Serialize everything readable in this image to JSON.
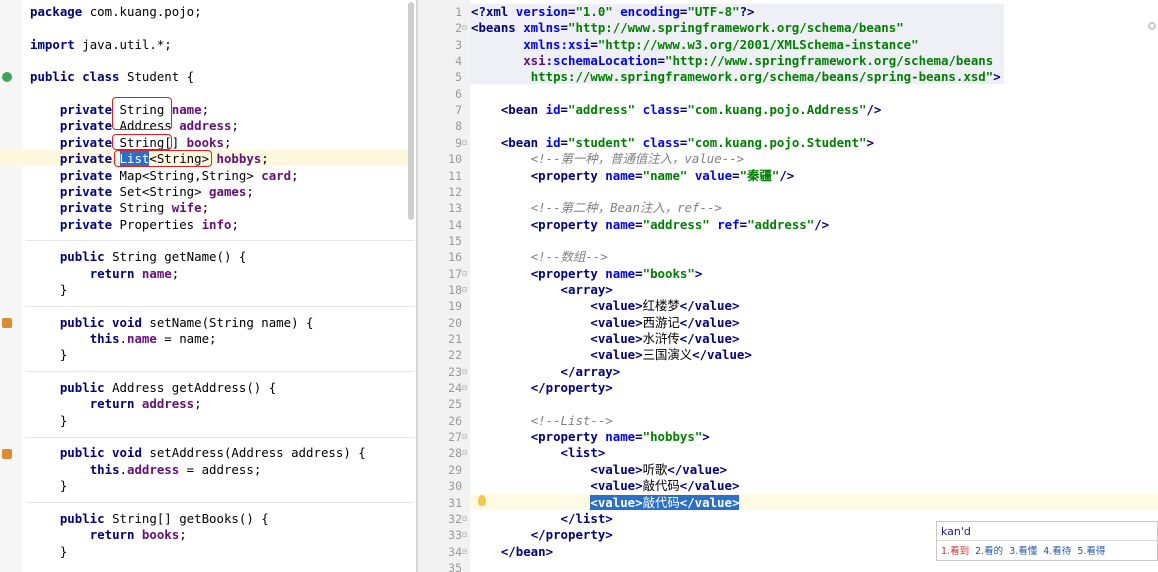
{
  "left_editor": {
    "lines": [
      {
        "parts": [
          [
            "kw",
            "package"
          ],
          [
            "",
            "com.kuang.pojo;"
          ]
        ]
      },
      {
        "parts": []
      },
      {
        "parts": [
          [
            "kw",
            "import"
          ],
          [
            "",
            "java.util.*;"
          ]
        ]
      },
      {
        "parts": []
      },
      {
        "parts": [
          [
            "kw",
            "public class"
          ],
          [
            "",
            "Student {"
          ]
        ]
      },
      {
        "parts": []
      },
      {
        "parts": [
          [
            "",
            "    "
          ],
          [
            "kw",
            "private"
          ],
          [
            "",
            " String "
          ],
          [
            "fld",
            "name"
          ],
          [
            "",
            ";"
          ]
        ]
      },
      {
        "parts": [
          [
            "",
            "    "
          ],
          [
            "kw",
            "private"
          ],
          [
            "",
            " Address "
          ],
          [
            "fld",
            "address"
          ],
          [
            "",
            ";"
          ]
        ]
      },
      {
        "parts": [
          [
            "",
            "    "
          ],
          [
            "kw",
            "private"
          ],
          [
            "",
            " String[] "
          ],
          [
            "fld",
            "books"
          ],
          [
            "",
            ";"
          ]
        ]
      },
      {
        "parts": [
          [
            "",
            "    "
          ],
          [
            "kw",
            "private"
          ],
          [
            "",
            ""
          ],
          [
            "sel",
            "List"
          ],
          [
            "",
            "<String> "
          ],
          [
            "fld",
            "hobbys"
          ],
          [
            "",
            ";"
          ]
        ]
      },
      {
        "parts": [
          [
            "",
            "    "
          ],
          [
            "kw",
            "private"
          ],
          [
            "",
            " Map<String,String> "
          ],
          [
            "fld",
            "card"
          ],
          [
            "",
            ";"
          ]
        ]
      },
      {
        "parts": [
          [
            "",
            "    "
          ],
          [
            "kw",
            "private"
          ],
          [
            "",
            " Set<String> "
          ],
          [
            "fld",
            "games"
          ],
          [
            "",
            ";"
          ]
        ]
      },
      {
        "parts": [
          [
            "",
            "    "
          ],
          [
            "kw",
            "private"
          ],
          [
            "",
            " String "
          ],
          [
            "fld",
            "wife"
          ],
          [
            "",
            ";"
          ]
        ]
      },
      {
        "parts": [
          [
            "",
            "    "
          ],
          [
            "kw",
            "private"
          ],
          [
            "",
            " Properties "
          ],
          [
            "fld",
            "info"
          ],
          [
            "",
            ";"
          ]
        ]
      },
      {
        "parts": []
      },
      {
        "parts": [
          [
            "",
            "    "
          ],
          [
            "kw",
            "public"
          ],
          [
            "",
            " String getName() {"
          ]
        ]
      },
      {
        "parts": [
          [
            "",
            "        "
          ],
          [
            "kw",
            "return"
          ],
          [
            "fld",
            "name"
          ],
          [
            "",
            ";"
          ]
        ]
      },
      {
        "parts": [
          [
            "",
            "    }"
          ]
        ]
      },
      {
        "parts": []
      },
      {
        "parts": [
          [
            "",
            "    "
          ],
          [
            "kw",
            "public void"
          ],
          [
            "",
            " setName(String name) {"
          ]
        ]
      },
      {
        "parts": [
          [
            "",
            "        "
          ],
          [
            "kw",
            "this"
          ],
          [
            "",
            "."
          ],
          [
            "fld",
            "name"
          ],
          [
            "",
            " = name;"
          ]
        ]
      },
      {
        "parts": [
          [
            "",
            "    }"
          ]
        ]
      },
      {
        "parts": []
      },
      {
        "parts": [
          [
            "",
            "    "
          ],
          [
            "kw",
            "public"
          ],
          [
            "",
            " Address getAddress() {"
          ]
        ]
      },
      {
        "parts": [
          [
            "",
            "        "
          ],
          [
            "kw",
            "return"
          ],
          [
            "fld",
            "address"
          ],
          [
            "",
            ";"
          ]
        ]
      },
      {
        "parts": [
          [
            "",
            "    }"
          ]
        ]
      },
      {
        "parts": []
      },
      {
        "parts": [
          [
            "",
            "    "
          ],
          [
            "kw",
            "public void"
          ],
          [
            "",
            " setAddress(Address address) {"
          ]
        ]
      },
      {
        "parts": [
          [
            "",
            "        "
          ],
          [
            "kw",
            "this"
          ],
          [
            "",
            "."
          ],
          [
            "fld",
            "address"
          ],
          [
            "",
            " = address;"
          ]
        ]
      },
      {
        "parts": [
          [
            "",
            "    }"
          ]
        ]
      },
      {
        "parts": []
      },
      {
        "parts": [
          [
            "",
            "    "
          ],
          [
            "kw",
            "public"
          ],
          [
            "",
            " String[] getBooks() {"
          ]
        ]
      },
      {
        "parts": [
          [
            "",
            "        "
          ],
          [
            "kw",
            "return"
          ],
          [
            "fld",
            "books"
          ],
          [
            "",
            ";"
          ]
        ]
      },
      {
        "parts": [
          [
            "",
            "    }"
          ]
        ]
      }
    ]
  },
  "right_editor": {
    "line_numbers": [
      "1",
      "2",
      "3",
      "4",
      "5",
      "6",
      "7",
      "8",
      "9",
      "10",
      "11",
      "12",
      "13",
      "14",
      "15",
      "16",
      "17",
      "18",
      "19",
      "20",
      "21",
      "22",
      "23",
      "24",
      "25",
      "26",
      "27",
      "28",
      "29",
      "30",
      "31",
      "32",
      "33",
      "34",
      "35"
    ],
    "lines": [
      {
        "parts": [
          [
            "tag",
            "<?xml "
          ],
          [
            "attr",
            "version"
          ],
          [
            "tag",
            "="
          ],
          [
            "val",
            "\"1.0\" "
          ],
          [
            "attr",
            "encoding"
          ],
          [
            "tag",
            "="
          ],
          [
            "val",
            "\"UTF-8\""
          ],
          [
            "tag",
            "?>"
          ]
        ]
      },
      {
        "parts": [
          [
            "tag",
            "<beans "
          ],
          [
            "attr",
            "xmlns"
          ],
          [
            "tag",
            "="
          ],
          [
            "val",
            "\"http://www.springframework.org/schema/beans\""
          ]
        ]
      },
      {
        "parts": [
          [
            "",
            "       "
          ],
          [
            "attr",
            "xmlns:xsi"
          ],
          [
            "tag",
            "="
          ],
          [
            "val",
            "\"http://www.w3.org/2001/XMLSchema-instance\""
          ]
        ]
      },
      {
        "parts": [
          [
            "",
            "       "
          ],
          [
            "ns",
            "xsi"
          ],
          [
            "attr",
            ":schemaLocation"
          ],
          [
            "tag",
            "="
          ],
          [
            "val",
            "\"http://www.springframework.org/schema/beans"
          ]
        ]
      },
      {
        "parts": [
          [
            "",
            "        "
          ],
          [
            "val",
            "https://www.springframework.org/schema/beans/spring-beans.xsd\""
          ],
          [
            "tag",
            ">"
          ]
        ]
      },
      {
        "parts": []
      },
      {
        "parts": [
          [
            "",
            "    "
          ],
          [
            "tag",
            "<bean "
          ],
          [
            "attr",
            "id"
          ],
          [
            "tag",
            "="
          ],
          [
            "val",
            "\"address\" "
          ],
          [
            "attr",
            "class"
          ],
          [
            "tag",
            "="
          ],
          [
            "val",
            "\"com.kuang.pojo.Address\""
          ],
          [
            "tag",
            "/>"
          ]
        ]
      },
      {
        "parts": []
      },
      {
        "parts": [
          [
            "",
            "    "
          ],
          [
            "tag",
            "<bean "
          ],
          [
            "attr",
            "id"
          ],
          [
            "tag",
            "="
          ],
          [
            "val",
            "\"student\" "
          ],
          [
            "attr",
            "class"
          ],
          [
            "tag",
            "="
          ],
          [
            "val",
            "\"com.kuang.pojo.Student\""
          ],
          [
            "tag",
            ">"
          ]
        ]
      },
      {
        "parts": [
          [
            "",
            "        "
          ],
          [
            "cmt",
            "<!--第一种，普通值注入，value-->"
          ]
        ]
      },
      {
        "parts": [
          [
            "",
            "        "
          ],
          [
            "tag",
            "<property "
          ],
          [
            "attr",
            "name"
          ],
          [
            "tag",
            "="
          ],
          [
            "val",
            "\"name\" "
          ],
          [
            "attr",
            "value"
          ],
          [
            "tag",
            "="
          ],
          [
            "val",
            "\"秦疆\""
          ],
          [
            "tag",
            "/>"
          ]
        ]
      },
      {
        "parts": []
      },
      {
        "parts": [
          [
            "",
            "        "
          ],
          [
            "cmt",
            "<!--第二种，Bean注入，ref-->"
          ]
        ]
      },
      {
        "parts": [
          [
            "",
            "        "
          ],
          [
            "tag",
            "<property "
          ],
          [
            "attr",
            "name"
          ],
          [
            "tag",
            "="
          ],
          [
            "val",
            "\"address\" "
          ],
          [
            "attr",
            "ref"
          ],
          [
            "tag",
            "="
          ],
          [
            "val",
            "\"address\""
          ],
          [
            "tag",
            "/>"
          ]
        ]
      },
      {
        "parts": []
      },
      {
        "parts": [
          [
            "",
            "        "
          ],
          [
            "cmt",
            "<!--数组-->"
          ]
        ]
      },
      {
        "parts": [
          [
            "",
            "        "
          ],
          [
            "tag",
            "<property "
          ],
          [
            "attr",
            "name"
          ],
          [
            "tag",
            "="
          ],
          [
            "val",
            "\"books\""
          ],
          [
            "tag",
            ">"
          ]
        ]
      },
      {
        "parts": [
          [
            "",
            "            "
          ],
          [
            "tag",
            "<array>"
          ]
        ]
      },
      {
        "parts": [
          [
            "",
            "                "
          ],
          [
            "tag",
            "<value>"
          ],
          [
            "",
            "红楼梦"
          ],
          [
            "tag",
            "</value>"
          ]
        ]
      },
      {
        "parts": [
          [
            "",
            "                "
          ],
          [
            "tag",
            "<value>"
          ],
          [
            "",
            "西游记"
          ],
          [
            "tag",
            "</value>"
          ]
        ]
      },
      {
        "parts": [
          [
            "",
            "                "
          ],
          [
            "tag",
            "<value>"
          ],
          [
            "",
            "水浒传"
          ],
          [
            "tag",
            "</value>"
          ]
        ]
      },
      {
        "parts": [
          [
            "",
            "                "
          ],
          [
            "tag",
            "<value>"
          ],
          [
            "",
            "三国演义"
          ],
          [
            "tag",
            "</value>"
          ]
        ]
      },
      {
        "parts": [
          [
            "",
            "            "
          ],
          [
            "tag",
            "</array>"
          ]
        ]
      },
      {
        "parts": [
          [
            "",
            "        "
          ],
          [
            "tag",
            "</property>"
          ]
        ]
      },
      {
        "parts": []
      },
      {
        "parts": [
          [
            "",
            "        "
          ],
          [
            "cmt",
            "<!--List-->"
          ]
        ]
      },
      {
        "parts": [
          [
            "",
            "        "
          ],
          [
            "tag",
            "<property "
          ],
          [
            "attr",
            "name"
          ],
          [
            "tag",
            "="
          ],
          [
            "val",
            "\"hobbys\""
          ],
          [
            "tag",
            ">"
          ]
        ]
      },
      {
        "parts": [
          [
            "",
            "            "
          ],
          [
            "tag",
            "<list>"
          ]
        ]
      },
      {
        "parts": [
          [
            "",
            "                "
          ],
          [
            "tag",
            "<value>"
          ],
          [
            "",
            "听歌"
          ],
          [
            "tag",
            "</value>"
          ]
        ]
      },
      {
        "parts": [
          [
            "",
            "                "
          ],
          [
            "tag",
            "<value>"
          ],
          [
            "",
            "敲代码"
          ],
          [
            "tag",
            "</value>"
          ]
        ]
      },
      {
        "parts": [
          [
            "",
            "                "
          ],
          [
            "seltag",
            "<value>"
          ],
          [
            "sel",
            "敲代码"
          ],
          [
            "seltag",
            "</value>"
          ]
        ]
      },
      {
        "parts": [
          [
            "",
            "            "
          ],
          [
            "tag",
            "</list>"
          ]
        ]
      },
      {
        "parts": [
          [
            "",
            "        "
          ],
          [
            "tag",
            "</property>"
          ]
        ]
      },
      {
        "parts": [
          [
            "",
            "    "
          ],
          [
            "tag",
            "</bean>"
          ]
        ]
      },
      {
        "parts": []
      }
    ]
  },
  "ime_popup": {
    "input": "kan'd",
    "candidates": [
      "1.看到",
      "2.看的",
      "3.看懂",
      "4.看待",
      "5.看得"
    ]
  }
}
